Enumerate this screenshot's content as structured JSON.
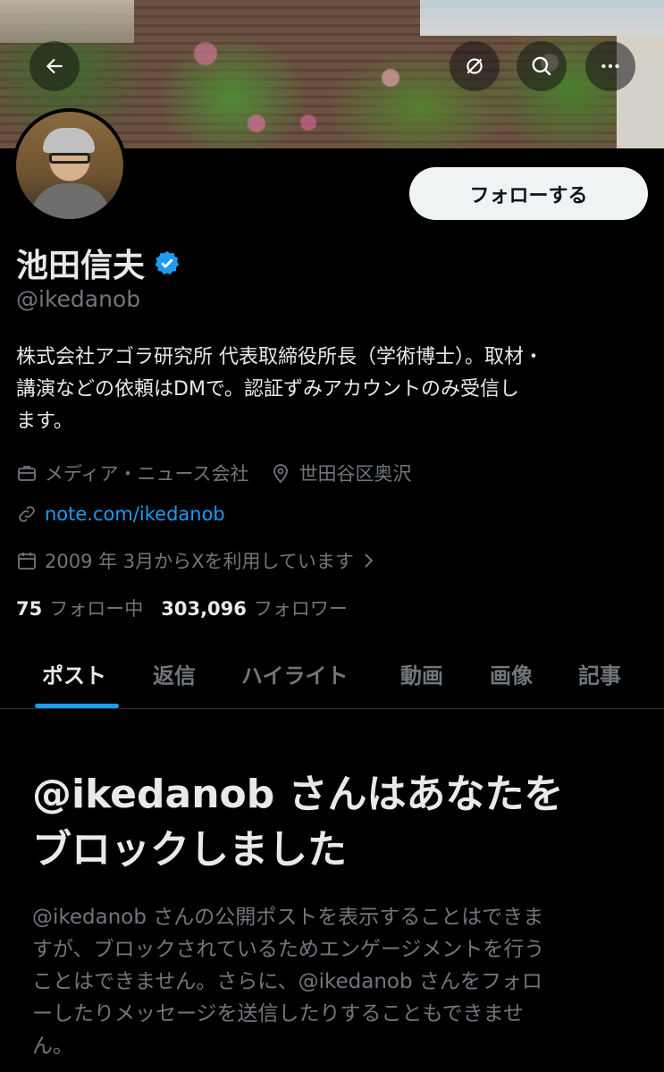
{
  "header": {
    "back_icon": "arrow-left-icon",
    "grok_icon": "grok-icon",
    "search_icon": "search-icon",
    "more_icon": "more-horizontal-icon"
  },
  "profile": {
    "display_name": "池田信夫",
    "verified": true,
    "handle": "@ikedanob",
    "follow_label": "フォローする",
    "bio_lines": [
      "株式会社アゴラ研究所 代表取締役所長（学術博士）。取材・",
      "講演などの依頼はDMで。認証ずみアカウントのみ受信し",
      "ます。"
    ],
    "category": "メディア・ニュース会社",
    "location": "世田谷区奥沢",
    "url": "note.com/ikedanob",
    "joined": "2009 年 3月からXを利用しています",
    "following_count": "75",
    "following_label": "フォロー中",
    "followers_count": "303,096",
    "followers_label": "フォロワー"
  },
  "tabs": [
    "ポスト",
    "返信",
    "ハイライト",
    "動画",
    "画像",
    "記事"
  ],
  "active_tab": "ポスト",
  "blocked": {
    "title_line1": "@ikedanob さんはあなたを",
    "title_line2": "ブロックしました",
    "message_lines": [
      "@ikedanob さんの公開ポストを表示することはできま",
      "すが、ブロックされているためエンゲージメントを行う",
      "ことはできません。さらに、@ikedanob さんをフォロ",
      "ーしたりメッセージを送信したりすることもできませ",
      "ん。"
    ]
  },
  "colors": {
    "background": "#000000",
    "accent": "#1d9bf0",
    "text_primary": "#e7e9ea",
    "text_secondary": "#71767b"
  }
}
